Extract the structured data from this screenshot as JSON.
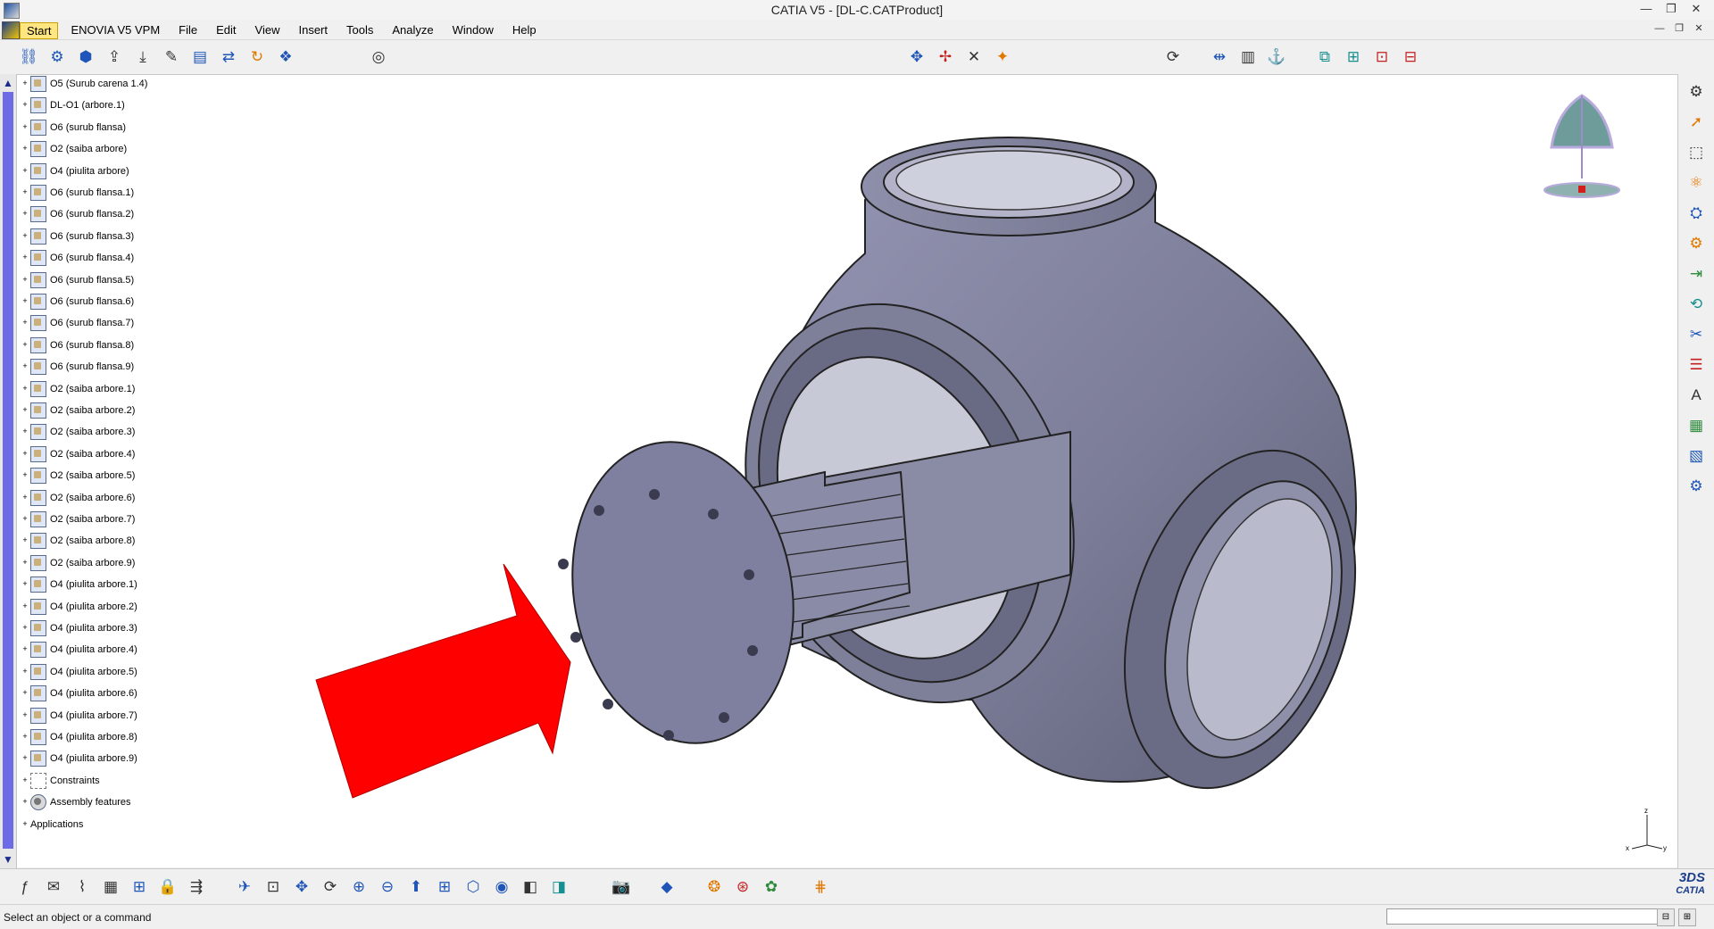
{
  "window": {
    "title": "CATIA V5 - [DL-C.CATProduct]",
    "controls": {
      "minimize": "—",
      "maximize": "❐",
      "close": "✕"
    }
  },
  "menu": {
    "items": [
      "Start",
      "ENOVIA V5 VPM",
      "File",
      "Edit",
      "View",
      "Insert",
      "Tools",
      "Analyze",
      "Window",
      "Help"
    ],
    "mdi_controls": {
      "minimize": "—",
      "restore": "❐",
      "close": "✕"
    }
  },
  "tree": {
    "items": [
      {
        "label": "O5 (Surub carena 1.4)",
        "icon": "part"
      },
      {
        "label": "DL-O1 (arbore.1)",
        "icon": "part"
      },
      {
        "label": "O6 (surub flansa)",
        "icon": "part"
      },
      {
        "label": "O2 (saiba arbore)",
        "icon": "part"
      },
      {
        "label": "O4 (piulita arbore)",
        "icon": "part"
      },
      {
        "label": "O6 (surub flansa.1)",
        "icon": "part"
      },
      {
        "label": "O6 (surub flansa.2)",
        "icon": "part"
      },
      {
        "label": "O6 (surub flansa.3)",
        "icon": "part"
      },
      {
        "label": "O6 (surub flansa.4)",
        "icon": "part"
      },
      {
        "label": "O6 (surub flansa.5)",
        "icon": "part"
      },
      {
        "label": "O6 (surub flansa.6)",
        "icon": "part"
      },
      {
        "label": "O6 (surub flansa.7)",
        "icon": "part"
      },
      {
        "label": "O6 (surub flansa.8)",
        "icon": "part"
      },
      {
        "label": "O6 (surub flansa.9)",
        "icon": "part"
      },
      {
        "label": "O2 (saiba arbore.1)",
        "icon": "part"
      },
      {
        "label": "O2 (saiba arbore.2)",
        "icon": "part"
      },
      {
        "label": "O2 (saiba arbore.3)",
        "icon": "part"
      },
      {
        "label": "O2 (saiba arbore.4)",
        "icon": "part"
      },
      {
        "label": "O2 (saiba arbore.5)",
        "icon": "part"
      },
      {
        "label": "O2 (saiba arbore.6)",
        "icon": "part"
      },
      {
        "label": "O2 (saiba arbore.7)",
        "icon": "part"
      },
      {
        "label": "O2 (saiba arbore.8)",
        "icon": "part"
      },
      {
        "label": "O2 (saiba arbore.9)",
        "icon": "part"
      },
      {
        "label": "O4 (piulita arbore.1)",
        "icon": "part"
      },
      {
        "label": "O4 (piulita arbore.2)",
        "icon": "part"
      },
      {
        "label": "O4 (piulita arbore.3)",
        "icon": "part"
      },
      {
        "label": "O4 (piulita arbore.4)",
        "icon": "part"
      },
      {
        "label": "O4 (piulita arbore.5)",
        "icon": "part"
      },
      {
        "label": "O4 (piulita arbore.6)",
        "icon": "part"
      },
      {
        "label": "O4 (piulita arbore.7)",
        "icon": "part"
      },
      {
        "label": "O4 (piulita arbore.8)",
        "icon": "part"
      },
      {
        "label": "O4 (piulita arbore.9)",
        "icon": "part"
      },
      {
        "label": "Constraints",
        "icon": "constraints"
      },
      {
        "label": "Assembly features",
        "icon": "gear"
      },
      {
        "label": "Applications",
        "icon": "none"
      }
    ]
  },
  "axes": {
    "x": "x",
    "y": "y",
    "z": "z"
  },
  "status": {
    "message": "Select an object or a command",
    "command_input": ""
  },
  "branding": {
    "logo_text": "CATIA",
    "logo_mark": "3DS"
  },
  "colors": {
    "model_body": "#7d7e98",
    "arrow": "#ff0000",
    "tree_scroll_thumb": "#6d6ce6",
    "menu_active": "#ffe680"
  }
}
